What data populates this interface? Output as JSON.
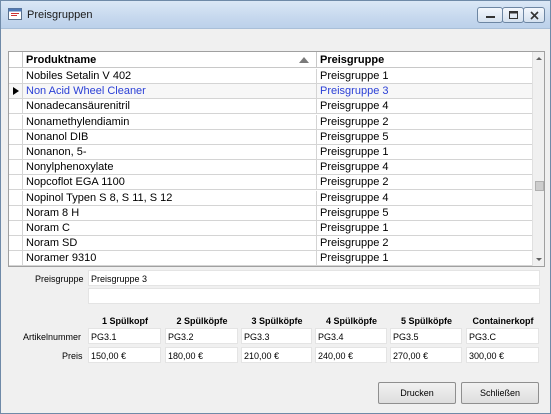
{
  "window": {
    "title": "Preisgruppen",
    "icon": "app-window-icon"
  },
  "grid": {
    "headers": {
      "product": "Produktname",
      "group": "Preisgruppe"
    },
    "sort": "ascending",
    "current_row": 1,
    "rows": [
      {
        "product": "Nobiles Setalin V 402",
        "group": "Preisgruppe 1"
      },
      {
        "product": "Non Acid Wheel Cleaner",
        "group": "Preisgruppe 3"
      },
      {
        "product": "Nonadecansäurenitril",
        "group": "Preisgruppe 4"
      },
      {
        "product": "Nonamethylendiamin",
        "group": "Preisgruppe 2"
      },
      {
        "product": "Nonanol DIB",
        "group": "Preisgruppe 5"
      },
      {
        "product": "Nonanon, 5-",
        "group": "Preisgruppe 1"
      },
      {
        "product": "Nonylphenoxylate",
        "group": "Preisgruppe 4"
      },
      {
        "product": "Nopcoflot EGA 1100",
        "group": "Preisgruppe 2"
      },
      {
        "product": "Nopinol Typen S 8, S 11, S 12",
        "group": "Preisgruppe 4"
      },
      {
        "product": "Noram 8 H",
        "group": "Preisgruppe 5"
      },
      {
        "product": "Noram C",
        "group": "Preisgruppe 1"
      },
      {
        "product": "Noram SD",
        "group": "Preisgruppe 2"
      },
      {
        "product": "Noramer 9310",
        "group": "Preisgruppe 1"
      }
    ]
  },
  "detail": {
    "preisgruppe_label": "Preisgruppe",
    "preisgruppe_value": "Preisgruppe 3",
    "description_value": "",
    "columns": [
      "1 Spülkopf",
      "2 Spülköpfe",
      "3 Spülköpfe",
      "4 Spülköpfe",
      "5 Spülköpfe",
      "Containerkopf"
    ],
    "artikelnummer_label": "Artikelnummer",
    "artikelnummern": [
      "PG3.1",
      "PG3.2",
      "PG3.3",
      "PG3.4",
      "PG3.5",
      "PG3.C"
    ],
    "preis_label": "Preis",
    "preise": [
      "150,00 €",
      "180,00 €",
      "210,00 €",
      "240,00 €",
      "270,00 €",
      "300,00 €"
    ]
  },
  "buttons": {
    "print": "Drucken",
    "close": "Schließen"
  },
  "colors": {
    "current_row_text": "#2a3fd6",
    "titlebar": "#c6d8ee"
  }
}
